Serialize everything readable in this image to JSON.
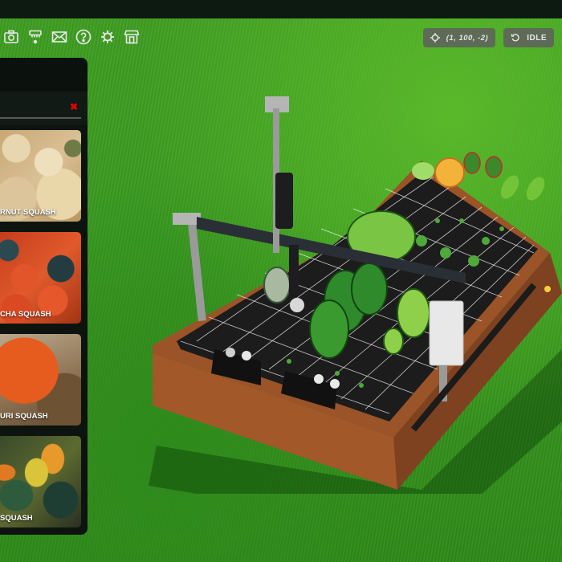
{
  "toolbar": {
    "icons": [
      {
        "name": "camera-icon",
        "label": "Photos"
      },
      {
        "name": "watering-nozzle-icon",
        "label": "Water"
      },
      {
        "name": "mail-icon",
        "label": "Messages"
      },
      {
        "name": "help-icon",
        "label": "Help"
      },
      {
        "name": "gear-icon",
        "label": "Settings"
      },
      {
        "name": "shop-icon",
        "label": "Shop"
      }
    ],
    "icon_color": "#e8e8e8"
  },
  "status": {
    "position": "(1, 100, -2)",
    "bot_state": "IDLE"
  },
  "panel": {
    "close_color": "#e00000",
    "close_symbol": "✖",
    "cards": [
      {
        "label": "BUTTERNUT SQUASH",
        "visible_label": "RNUT SQUASH"
      },
      {
        "label": "KABOCHA SQUASH",
        "visible_label": "CHA SQUASH"
      },
      {
        "label": "RED KURI SQUASH",
        "visible_label": "URI SQUASH"
      },
      {
        "label": "ORNAMENTAL SQUASH",
        "visible_label": "SQUASH"
      }
    ]
  },
  "colors": {
    "topbar": "#0d1a12",
    "panel_bg": "#0d1410",
    "pill_bg": "#5f5f5f",
    "grass": "#3a9a20",
    "soil": "#1a1a1a",
    "wood": "#8a4a22"
  }
}
